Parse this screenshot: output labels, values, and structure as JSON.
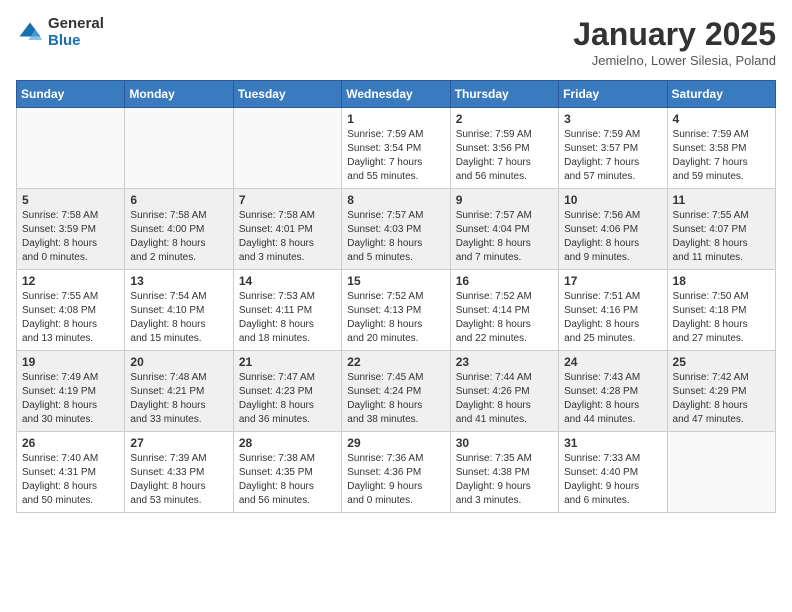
{
  "header": {
    "logo_general": "General",
    "logo_blue": "Blue",
    "month_title": "January 2025",
    "subtitle": "Jemielno, Lower Silesia, Poland"
  },
  "days_of_week": [
    "Sunday",
    "Monday",
    "Tuesday",
    "Wednesday",
    "Thursday",
    "Friday",
    "Saturday"
  ],
  "weeks": [
    [
      {
        "num": "",
        "info": ""
      },
      {
        "num": "",
        "info": ""
      },
      {
        "num": "",
        "info": ""
      },
      {
        "num": "1",
        "info": "Sunrise: 7:59 AM\nSunset: 3:54 PM\nDaylight: 7 hours\nand 55 minutes."
      },
      {
        "num": "2",
        "info": "Sunrise: 7:59 AM\nSunset: 3:56 PM\nDaylight: 7 hours\nand 56 minutes."
      },
      {
        "num": "3",
        "info": "Sunrise: 7:59 AM\nSunset: 3:57 PM\nDaylight: 7 hours\nand 57 minutes."
      },
      {
        "num": "4",
        "info": "Sunrise: 7:59 AM\nSunset: 3:58 PM\nDaylight: 7 hours\nand 59 minutes."
      }
    ],
    [
      {
        "num": "5",
        "info": "Sunrise: 7:58 AM\nSunset: 3:59 PM\nDaylight: 8 hours\nand 0 minutes."
      },
      {
        "num": "6",
        "info": "Sunrise: 7:58 AM\nSunset: 4:00 PM\nDaylight: 8 hours\nand 2 minutes."
      },
      {
        "num": "7",
        "info": "Sunrise: 7:58 AM\nSunset: 4:01 PM\nDaylight: 8 hours\nand 3 minutes."
      },
      {
        "num": "8",
        "info": "Sunrise: 7:57 AM\nSunset: 4:03 PM\nDaylight: 8 hours\nand 5 minutes."
      },
      {
        "num": "9",
        "info": "Sunrise: 7:57 AM\nSunset: 4:04 PM\nDaylight: 8 hours\nand 7 minutes."
      },
      {
        "num": "10",
        "info": "Sunrise: 7:56 AM\nSunset: 4:06 PM\nDaylight: 8 hours\nand 9 minutes."
      },
      {
        "num": "11",
        "info": "Sunrise: 7:55 AM\nSunset: 4:07 PM\nDaylight: 8 hours\nand 11 minutes."
      }
    ],
    [
      {
        "num": "12",
        "info": "Sunrise: 7:55 AM\nSunset: 4:08 PM\nDaylight: 8 hours\nand 13 minutes."
      },
      {
        "num": "13",
        "info": "Sunrise: 7:54 AM\nSunset: 4:10 PM\nDaylight: 8 hours\nand 15 minutes."
      },
      {
        "num": "14",
        "info": "Sunrise: 7:53 AM\nSunset: 4:11 PM\nDaylight: 8 hours\nand 18 minutes."
      },
      {
        "num": "15",
        "info": "Sunrise: 7:52 AM\nSunset: 4:13 PM\nDaylight: 8 hours\nand 20 minutes."
      },
      {
        "num": "16",
        "info": "Sunrise: 7:52 AM\nSunset: 4:14 PM\nDaylight: 8 hours\nand 22 minutes."
      },
      {
        "num": "17",
        "info": "Sunrise: 7:51 AM\nSunset: 4:16 PM\nDaylight: 8 hours\nand 25 minutes."
      },
      {
        "num": "18",
        "info": "Sunrise: 7:50 AM\nSunset: 4:18 PM\nDaylight: 8 hours\nand 27 minutes."
      }
    ],
    [
      {
        "num": "19",
        "info": "Sunrise: 7:49 AM\nSunset: 4:19 PM\nDaylight: 8 hours\nand 30 minutes."
      },
      {
        "num": "20",
        "info": "Sunrise: 7:48 AM\nSunset: 4:21 PM\nDaylight: 8 hours\nand 33 minutes."
      },
      {
        "num": "21",
        "info": "Sunrise: 7:47 AM\nSunset: 4:23 PM\nDaylight: 8 hours\nand 36 minutes."
      },
      {
        "num": "22",
        "info": "Sunrise: 7:45 AM\nSunset: 4:24 PM\nDaylight: 8 hours\nand 38 minutes."
      },
      {
        "num": "23",
        "info": "Sunrise: 7:44 AM\nSunset: 4:26 PM\nDaylight: 8 hours\nand 41 minutes."
      },
      {
        "num": "24",
        "info": "Sunrise: 7:43 AM\nSunset: 4:28 PM\nDaylight: 8 hours\nand 44 minutes."
      },
      {
        "num": "25",
        "info": "Sunrise: 7:42 AM\nSunset: 4:29 PM\nDaylight: 8 hours\nand 47 minutes."
      }
    ],
    [
      {
        "num": "26",
        "info": "Sunrise: 7:40 AM\nSunset: 4:31 PM\nDaylight: 8 hours\nand 50 minutes."
      },
      {
        "num": "27",
        "info": "Sunrise: 7:39 AM\nSunset: 4:33 PM\nDaylight: 8 hours\nand 53 minutes."
      },
      {
        "num": "28",
        "info": "Sunrise: 7:38 AM\nSunset: 4:35 PM\nDaylight: 8 hours\nand 56 minutes."
      },
      {
        "num": "29",
        "info": "Sunrise: 7:36 AM\nSunset: 4:36 PM\nDaylight: 9 hours\nand 0 minutes."
      },
      {
        "num": "30",
        "info": "Sunrise: 7:35 AM\nSunset: 4:38 PM\nDaylight: 9 hours\nand 3 minutes."
      },
      {
        "num": "31",
        "info": "Sunrise: 7:33 AM\nSunset: 4:40 PM\nDaylight: 9 hours\nand 6 minutes."
      },
      {
        "num": "",
        "info": ""
      }
    ]
  ]
}
